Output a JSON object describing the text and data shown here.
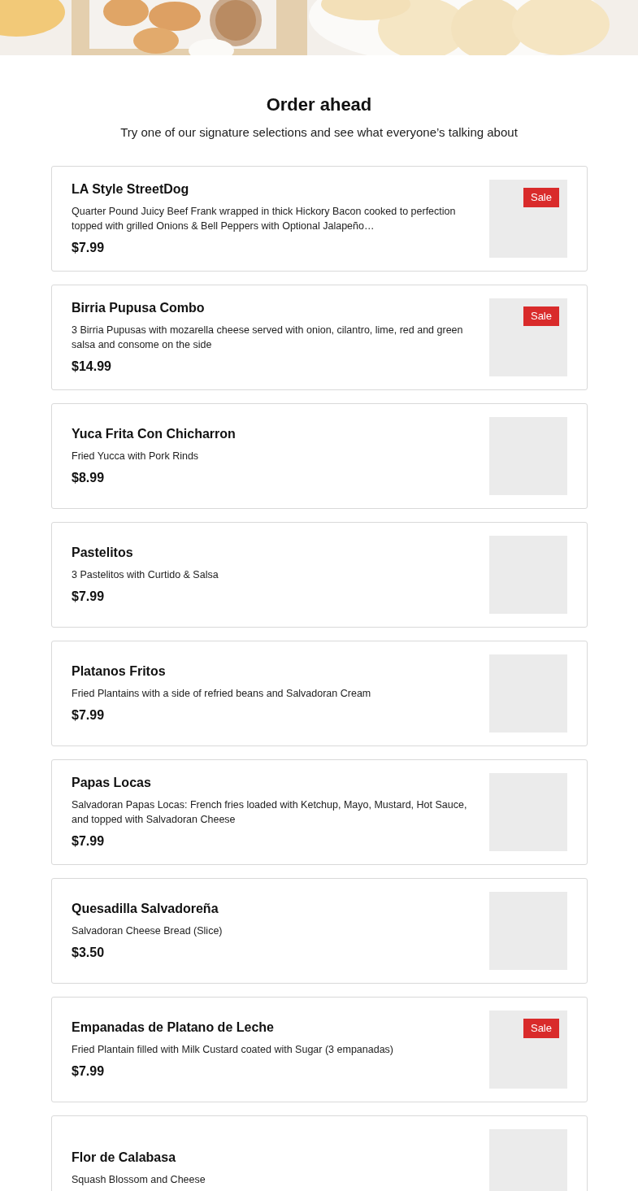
{
  "heading": "Order ahead",
  "subheading": "Try one of our signature selections and see what everyone’s talking about",
  "items": [
    {
      "name": "LA Style StreetDog",
      "description": "Quarter Pound Juicy Beef Frank wrapped in thick Hickory Bacon cooked to perfection topped with grilled Onions & Bell Peppers with Optional Jalapeño…",
      "price": "$7.99",
      "badge": "Sale"
    },
    {
      "name": "Birria Pupusa Combo",
      "description": "3 Birria Pupusas with mozarella cheese served with onion, cilantro, lime, red and green salsa and consome on the side",
      "price": "$14.99",
      "badge": "Sale"
    },
    {
      "name": "Yuca Frita Con Chicharron",
      "description": "Fried Yucca with Pork Rinds",
      "price": "$8.99"
    },
    {
      "name": "Pastelitos",
      "description": "3 Pastelitos with Curtido & Salsa",
      "price": "$7.99"
    },
    {
      "name": "Platanos Fritos",
      "description": "Fried Plantains with a side of refried beans and Salvadoran Cream",
      "price": "$7.99"
    },
    {
      "name": "Papas Locas",
      "description": "Salvadoran Papas Locas: French fries loaded with Ketchup, Mayo, Mustard, Hot Sauce, and topped with Salvadoran Cheese",
      "price": "$7.99"
    },
    {
      "name": "Quesadilla Salvadoreña",
      "description": "Salvadoran Cheese Bread (Slice)",
      "price": "$3.50"
    },
    {
      "name": "Empanadas de Platano de Leche",
      "description": "Fried Plantain filled with Milk Custard coated with Sugar (3 empanadas)",
      "price": "$7.99",
      "badge": "Sale"
    },
    {
      "name": "Flor de Calabasa",
      "description": "Squash Blossom and Cheese"
    }
  ]
}
